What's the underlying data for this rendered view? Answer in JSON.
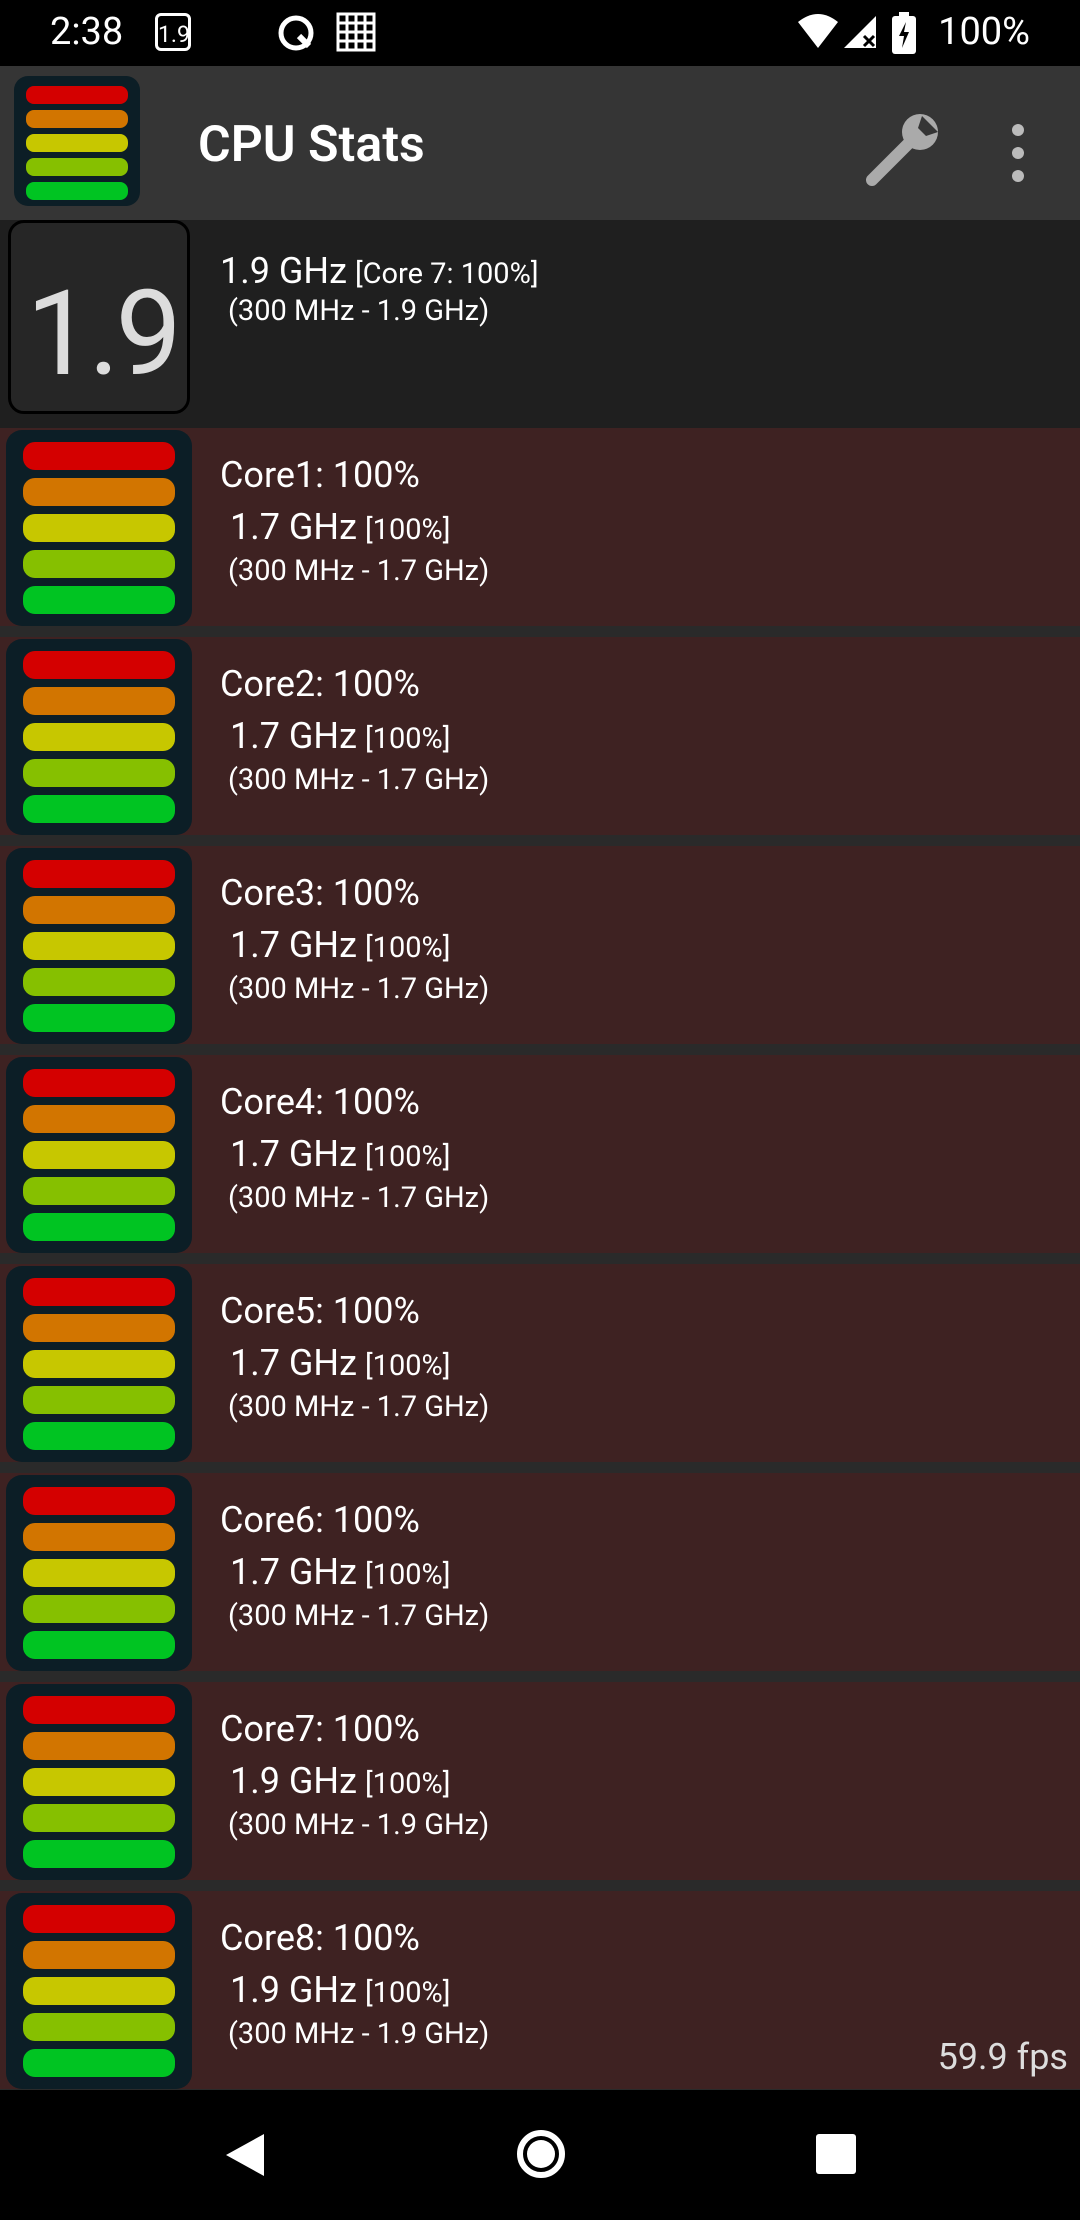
{
  "status_bar": {
    "time": "2:38",
    "badge": "1.9",
    "battery": "100%",
    "icons": [
      "qualcomm-logo-icon",
      "grid-icon",
      "wifi-icon",
      "signal-off-icon",
      "battery-charging-icon"
    ]
  },
  "app_bar": {
    "title": "CPU Stats",
    "icons": [
      "app-logo-icon",
      "wrench-icon",
      "more-vertical-icon"
    ]
  },
  "summary": {
    "big_number": "1.9",
    "frequency": "1.9 GHz",
    "top_core": "[Core 7: 100%]",
    "range": "(300 MHz - 1.9 GHz)"
  },
  "cores": [
    {
      "name": "Core1: 100%",
      "freq": "1.7 GHz",
      "load": "[100%]",
      "range": "(300 MHz - 1.7 GHz)"
    },
    {
      "name": "Core2: 100%",
      "freq": "1.7 GHz",
      "load": "[100%]",
      "range": "(300 MHz - 1.7 GHz)"
    },
    {
      "name": "Core3: 100%",
      "freq": "1.7 GHz",
      "load": "[100%]",
      "range": "(300 MHz - 1.7 GHz)"
    },
    {
      "name": "Core4: 100%",
      "freq": "1.7 GHz",
      "load": "[100%]",
      "range": "(300 MHz - 1.7 GHz)"
    },
    {
      "name": "Core5: 100%",
      "freq": "1.7 GHz",
      "load": "[100%]",
      "range": "(300 MHz - 1.7 GHz)"
    },
    {
      "name": "Core6: 100%",
      "freq": "1.7 GHz",
      "load": "[100%]",
      "range": "(300 MHz - 1.7 GHz)"
    },
    {
      "name": "Core7: 100%",
      "freq": "1.9 GHz",
      "load": "[100%]",
      "range": "(300 MHz - 1.9 GHz)"
    },
    {
      "name": "Core8: 100%",
      "freq": "1.9 GHz",
      "load": "[100%]",
      "range": "(300 MHz - 1.9 GHz)"
    }
  ],
  "fps": "59.9 fps",
  "colors": {
    "row_bg": "#3e2222",
    "meter_bg": "#0c1e26",
    "bar_red": "#d40000",
    "bar_orange": "#d27500",
    "bar_yellow": "#c7c700",
    "bar_lime": "#86c000",
    "bar_green": "#00c422"
  },
  "nav_bar": {
    "icons": [
      "back-icon",
      "home-icon",
      "recents-icon"
    ]
  }
}
